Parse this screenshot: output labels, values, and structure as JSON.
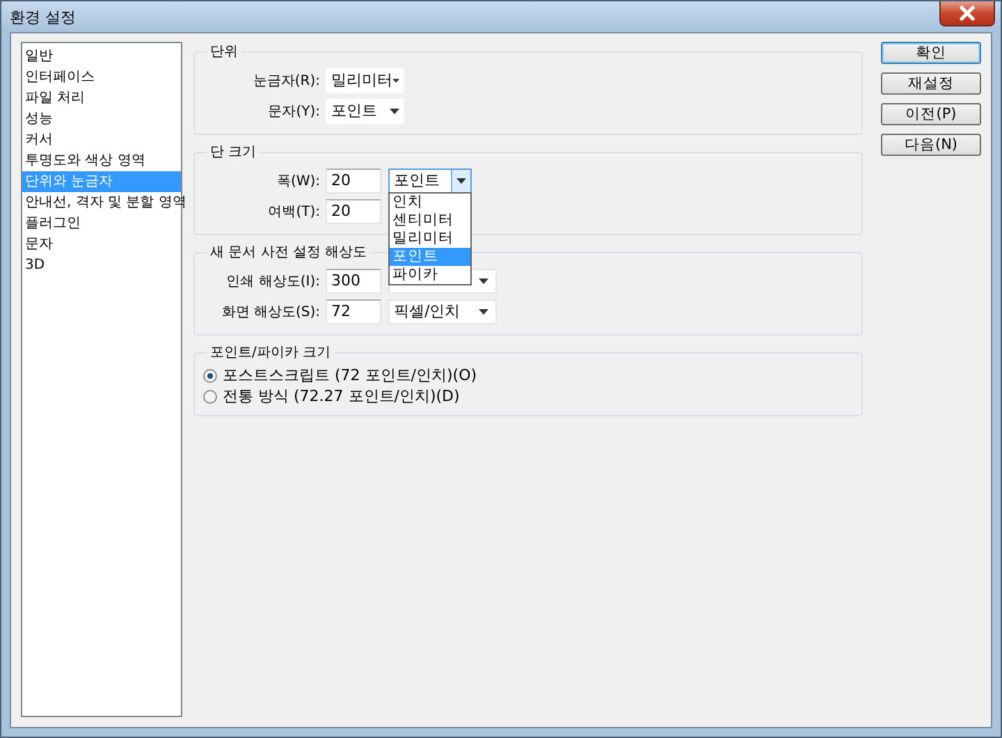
{
  "window": {
    "title": "환경 설정"
  },
  "sidebar": {
    "items": [
      {
        "label": "일반",
        "selected": false
      },
      {
        "label": "인터페이스",
        "selected": false
      },
      {
        "label": "파일 처리",
        "selected": false
      },
      {
        "label": "성능",
        "selected": false
      },
      {
        "label": "커서",
        "selected": false
      },
      {
        "label": "투명도와 색상 영역",
        "selected": false
      },
      {
        "label": "단위와 눈금자",
        "selected": true
      },
      {
        "label": "안내선, 격자 및 분할 영역",
        "selected": false
      },
      {
        "label": "플러그인",
        "selected": false
      },
      {
        "label": "문자",
        "selected": false
      },
      {
        "label": "3D",
        "selected": false
      }
    ]
  },
  "units": {
    "title": "단위",
    "rows": [
      {
        "label": "눈금자(R):",
        "value": "밀리미터"
      },
      {
        "label": "문자(Y):",
        "value": "포인트"
      }
    ]
  },
  "column_size": {
    "title": "단 크기",
    "menu_open": true,
    "rows": [
      {
        "label": "폭(W):",
        "value": "20",
        "unit": "포인트"
      },
      {
        "label": "여백(T):",
        "value": "20"
      }
    ],
    "dropdown_options": [
      {
        "label": "인치",
        "selected": false
      },
      {
        "label": "센티미터",
        "selected": false
      },
      {
        "label": "밀리미터",
        "selected": false
      },
      {
        "label": "포인트",
        "selected": true
      },
      {
        "label": "파이카",
        "selected": false
      }
    ]
  },
  "resolution": {
    "title": "새 문서 사전 설정 해상도",
    "rows": [
      {
        "label": "인쇄 해상도(I):",
        "value": "300"
      },
      {
        "label": "화면 해상도(S):",
        "value": "72",
        "unit": "픽셀/인치"
      }
    ]
  },
  "point_size": {
    "title": "포인트/파이카 크기",
    "options": [
      {
        "label": "포스트스크립트 (72 포인트/인치)(O)",
        "selected": true
      },
      {
        "label": "전통 방식 (72.27 포인트/인치)(D)",
        "selected": false
      }
    ]
  },
  "buttons": [
    {
      "label": "확인",
      "default": true
    },
    {
      "label": "재설정",
      "default": false
    },
    {
      "label": "이전(P)",
      "default": false
    },
    {
      "label": "다음(N)",
      "default": false
    }
  ]
}
